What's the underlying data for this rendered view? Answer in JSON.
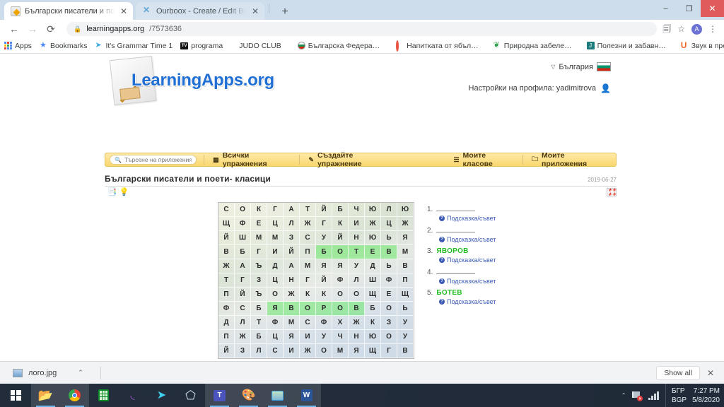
{
  "browser": {
    "tabs": [
      {
        "title": "Български писатели и поети- кл",
        "favicon": "learningapps-favicon",
        "active": true,
        "close_label": "✕"
      },
      {
        "title": "Ourboox - Create / Edit Book",
        "favicon": "ourboox-favicon",
        "active": false,
        "close_label": "✕"
      }
    ],
    "new_tab_label": "+",
    "window_controls": {
      "minimize": "–",
      "maximize": "❐",
      "close": "✕"
    },
    "nav": {
      "back": "←",
      "forward": "→",
      "reload": "⟳"
    },
    "omnibox": {
      "lock": "🔒",
      "host": "learningapps.org",
      "path": "/7573636",
      "full_url": "learningapps.org/7573636"
    },
    "toolbar_icons": {
      "translate": "⎙",
      "bookmark_star": "☆",
      "profile_initial": "A",
      "menu": "⋮"
    },
    "bookmarks": [
      {
        "label": "Apps",
        "icon": "apps-grid-icon"
      },
      {
        "label": "Bookmarks",
        "icon": "star-icon"
      },
      {
        "label": "It's Grammar Time 1",
        "icon": "telegram-icon"
      },
      {
        "label": "programa",
        "icon": "tv-icon"
      },
      {
        "label": "JUDO CLUB",
        "icon": "none"
      },
      {
        "label": "Българска Федера…",
        "icon": "bg-flag-icon"
      },
      {
        "label": "Напитката от ябъл…",
        "icon": "ring-icon"
      },
      {
        "label": "Природна забеле…",
        "icon": "leaf-icon"
      },
      {
        "label": "Полезни и забавн…",
        "icon": "j-square-icon"
      },
      {
        "label": "Звук в презентаци…",
        "icon": "u-icon"
      }
    ],
    "bookmarks_overflow": "»"
  },
  "site": {
    "logo_text": "LearningApps.org",
    "country": {
      "caret": "▽",
      "label": "България",
      "flag": "bulgaria-flag"
    },
    "profile": {
      "label": "Настройки на профила: yadimitrova",
      "icon": "person-icon"
    },
    "nav": {
      "search_placeholder": "Търсене на приложения",
      "search_value": "",
      "items": [
        {
          "label": "Всички упражнения",
          "icon": "grid-icon"
        },
        {
          "label": "Създайте упражнение",
          "icon": "pencil-icon"
        },
        {
          "label": "Моите класове",
          "icon": "list-icon"
        },
        {
          "label": "Моите приложения",
          "icon": "folder-icon"
        }
      ]
    }
  },
  "exercise": {
    "title": "Български писатели и поети- класици",
    "date": "2019-06-27",
    "tool_icons": [
      {
        "name": "info-doc-icon",
        "glyph": "▤"
      },
      {
        "name": "lightbulb-icon",
        "glyph": "💡"
      }
    ],
    "fullscreen_icon": "fullscreen-icon"
  },
  "wordsearch": {
    "rows": 12,
    "cols": 12,
    "grid": [
      [
        "С",
        "О",
        "К",
        "Г",
        "А",
        "Т",
        "Й",
        "Б",
        "Ч",
        "Ю",
        "Л",
        "Ю"
      ],
      [
        "Щ",
        "Ф",
        "Е",
        "Ц",
        "Л",
        "Ж",
        "Г",
        "К",
        "И",
        "Ж",
        "Ц",
        "Ж"
      ],
      [
        "Й",
        "Ш",
        "М",
        "М",
        "З",
        "С",
        "У",
        "Й",
        "Н",
        "Ю",
        "Ь",
        "Я"
      ],
      [
        "В",
        "Б",
        "Г",
        "И",
        "Й",
        "П",
        "Б",
        "О",
        "Т",
        "Е",
        "В",
        "М"
      ],
      [
        "Ж",
        "А",
        "Ъ",
        "Д",
        "А",
        "М",
        "Я",
        "Я",
        "У",
        "Д",
        "Ь",
        "В"
      ],
      [
        "Т",
        "Г",
        "З",
        "Ц",
        "Н",
        "Г",
        "Й",
        "Ф",
        "Л",
        "Ш",
        "Ф",
        "П"
      ],
      [
        "П",
        "Й",
        "Ъ",
        "О",
        "Ж",
        "К",
        "К",
        "О",
        "О",
        "Щ",
        "Е",
        "Щ"
      ],
      [
        "Ф",
        "С",
        "Б",
        "Я",
        "В",
        "О",
        "Р",
        "О",
        "В",
        "Б",
        "О",
        "Ь"
      ],
      [
        "Д",
        "Л",
        "Т",
        "Ф",
        "М",
        "С",
        "Ф",
        "Х",
        "Ж",
        "К",
        "З",
        "У"
      ],
      [
        "П",
        "Ж",
        "Б",
        "Ц",
        "Я",
        "И",
        "У",
        "Ч",
        "Н",
        "Ю",
        "О",
        "У"
      ],
      [
        "Й",
        "З",
        "Л",
        "С",
        "И",
        "Ж",
        "О",
        "М",
        "Я",
        "Щ",
        "Г",
        "В"
      ]
    ],
    "highlights": [
      {
        "row": 3,
        "cols": [
          6,
          7,
          8,
          9,
          10
        ]
      },
      {
        "row": 7,
        "cols": [
          3,
          4,
          5,
          6,
          7,
          8
        ]
      }
    ],
    "words": [
      {
        "num": "1.",
        "solved": false,
        "text": "",
        "hint": "Подсказка/съвет"
      },
      {
        "num": "2.",
        "solved": false,
        "text": "",
        "hint": "Подсказка/съвет"
      },
      {
        "num": "3.",
        "solved": true,
        "text": "ЯВОРОВ",
        "hint": "Подсказка/съвет"
      },
      {
        "num": "4.",
        "solved": false,
        "text": "",
        "hint": "Подсказка/съвет"
      },
      {
        "num": "5.",
        "solved": true,
        "text": "БОТЕВ",
        "hint": "Подсказка/съвет"
      }
    ],
    "solved_color": "#22bb22",
    "highlight_color": "#96f596"
  },
  "downloads": {
    "item": {
      "filename": "лого.jpg",
      "caret": "⌃",
      "thumb": "image-thumbnail"
    },
    "show_all_label": "Show all",
    "close_label": "✕"
  },
  "taskbar": {
    "start": "windows-logo",
    "apps": [
      {
        "name": "file-explorer",
        "glyph": "🗂"
      },
      {
        "name": "google-chrome",
        "glyph": ""
      },
      {
        "name": "calculator",
        "glyph": ""
      },
      {
        "name": "visual-studio-code",
        "glyph": "⧓"
      },
      {
        "name": "telegram",
        "glyph": "➤"
      },
      {
        "name": "3d-viewer",
        "glyph": "⬡"
      },
      {
        "name": "microsoft-teams",
        "glyph": "T"
      },
      {
        "name": "paint-3d",
        "glyph": "🎨"
      },
      {
        "name": "photos",
        "glyph": ""
      },
      {
        "name": "microsoft-word",
        "glyph": "W"
      }
    ],
    "tray": {
      "caret": "⌃",
      "network_icon": "network-error-icon",
      "signal_icon": "signal-bars-icon",
      "lang_line1": "БГР",
      "lang_line2": "BGP",
      "time": "7:27 PM",
      "date": "5/8/2020"
    }
  }
}
